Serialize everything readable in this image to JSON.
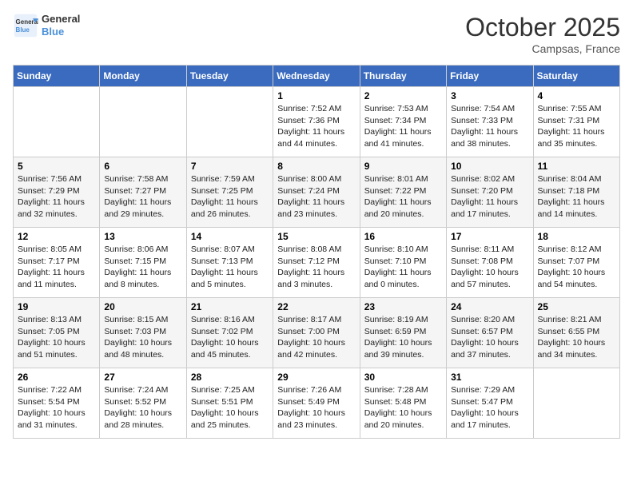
{
  "header": {
    "logo_line1": "General",
    "logo_line2": "Blue",
    "month": "October 2025",
    "location": "Campsas, France"
  },
  "weekdays": [
    "Sunday",
    "Monday",
    "Tuesday",
    "Wednesday",
    "Thursday",
    "Friday",
    "Saturday"
  ],
  "weeks": [
    [
      {
        "day": "",
        "info": ""
      },
      {
        "day": "",
        "info": ""
      },
      {
        "day": "",
        "info": ""
      },
      {
        "day": "1",
        "info": "Sunrise: 7:52 AM\nSunset: 7:36 PM\nDaylight: 11 hours\nand 44 minutes."
      },
      {
        "day": "2",
        "info": "Sunrise: 7:53 AM\nSunset: 7:34 PM\nDaylight: 11 hours\nand 41 minutes."
      },
      {
        "day": "3",
        "info": "Sunrise: 7:54 AM\nSunset: 7:33 PM\nDaylight: 11 hours\nand 38 minutes."
      },
      {
        "day": "4",
        "info": "Sunrise: 7:55 AM\nSunset: 7:31 PM\nDaylight: 11 hours\nand 35 minutes."
      }
    ],
    [
      {
        "day": "5",
        "info": "Sunrise: 7:56 AM\nSunset: 7:29 PM\nDaylight: 11 hours\nand 32 minutes."
      },
      {
        "day": "6",
        "info": "Sunrise: 7:58 AM\nSunset: 7:27 PM\nDaylight: 11 hours\nand 29 minutes."
      },
      {
        "day": "7",
        "info": "Sunrise: 7:59 AM\nSunset: 7:25 PM\nDaylight: 11 hours\nand 26 minutes."
      },
      {
        "day": "8",
        "info": "Sunrise: 8:00 AM\nSunset: 7:24 PM\nDaylight: 11 hours\nand 23 minutes."
      },
      {
        "day": "9",
        "info": "Sunrise: 8:01 AM\nSunset: 7:22 PM\nDaylight: 11 hours\nand 20 minutes."
      },
      {
        "day": "10",
        "info": "Sunrise: 8:02 AM\nSunset: 7:20 PM\nDaylight: 11 hours\nand 17 minutes."
      },
      {
        "day": "11",
        "info": "Sunrise: 8:04 AM\nSunset: 7:18 PM\nDaylight: 11 hours\nand 14 minutes."
      }
    ],
    [
      {
        "day": "12",
        "info": "Sunrise: 8:05 AM\nSunset: 7:17 PM\nDaylight: 11 hours\nand 11 minutes."
      },
      {
        "day": "13",
        "info": "Sunrise: 8:06 AM\nSunset: 7:15 PM\nDaylight: 11 hours\nand 8 minutes."
      },
      {
        "day": "14",
        "info": "Sunrise: 8:07 AM\nSunset: 7:13 PM\nDaylight: 11 hours\nand 5 minutes."
      },
      {
        "day": "15",
        "info": "Sunrise: 8:08 AM\nSunset: 7:12 PM\nDaylight: 11 hours\nand 3 minutes."
      },
      {
        "day": "16",
        "info": "Sunrise: 8:10 AM\nSunset: 7:10 PM\nDaylight: 11 hours\nand 0 minutes."
      },
      {
        "day": "17",
        "info": "Sunrise: 8:11 AM\nSunset: 7:08 PM\nDaylight: 10 hours\nand 57 minutes."
      },
      {
        "day": "18",
        "info": "Sunrise: 8:12 AM\nSunset: 7:07 PM\nDaylight: 10 hours\nand 54 minutes."
      }
    ],
    [
      {
        "day": "19",
        "info": "Sunrise: 8:13 AM\nSunset: 7:05 PM\nDaylight: 10 hours\nand 51 minutes."
      },
      {
        "day": "20",
        "info": "Sunrise: 8:15 AM\nSunset: 7:03 PM\nDaylight: 10 hours\nand 48 minutes."
      },
      {
        "day": "21",
        "info": "Sunrise: 8:16 AM\nSunset: 7:02 PM\nDaylight: 10 hours\nand 45 minutes."
      },
      {
        "day": "22",
        "info": "Sunrise: 8:17 AM\nSunset: 7:00 PM\nDaylight: 10 hours\nand 42 minutes."
      },
      {
        "day": "23",
        "info": "Sunrise: 8:19 AM\nSunset: 6:59 PM\nDaylight: 10 hours\nand 39 minutes."
      },
      {
        "day": "24",
        "info": "Sunrise: 8:20 AM\nSunset: 6:57 PM\nDaylight: 10 hours\nand 37 minutes."
      },
      {
        "day": "25",
        "info": "Sunrise: 8:21 AM\nSunset: 6:55 PM\nDaylight: 10 hours\nand 34 minutes."
      }
    ],
    [
      {
        "day": "26",
        "info": "Sunrise: 7:22 AM\nSunset: 5:54 PM\nDaylight: 10 hours\nand 31 minutes."
      },
      {
        "day": "27",
        "info": "Sunrise: 7:24 AM\nSunset: 5:52 PM\nDaylight: 10 hours\nand 28 minutes."
      },
      {
        "day": "28",
        "info": "Sunrise: 7:25 AM\nSunset: 5:51 PM\nDaylight: 10 hours\nand 25 minutes."
      },
      {
        "day": "29",
        "info": "Sunrise: 7:26 AM\nSunset: 5:49 PM\nDaylight: 10 hours\nand 23 minutes."
      },
      {
        "day": "30",
        "info": "Sunrise: 7:28 AM\nSunset: 5:48 PM\nDaylight: 10 hours\nand 20 minutes."
      },
      {
        "day": "31",
        "info": "Sunrise: 7:29 AM\nSunset: 5:47 PM\nDaylight: 10 hours\nand 17 minutes."
      },
      {
        "day": "",
        "info": ""
      }
    ]
  ]
}
